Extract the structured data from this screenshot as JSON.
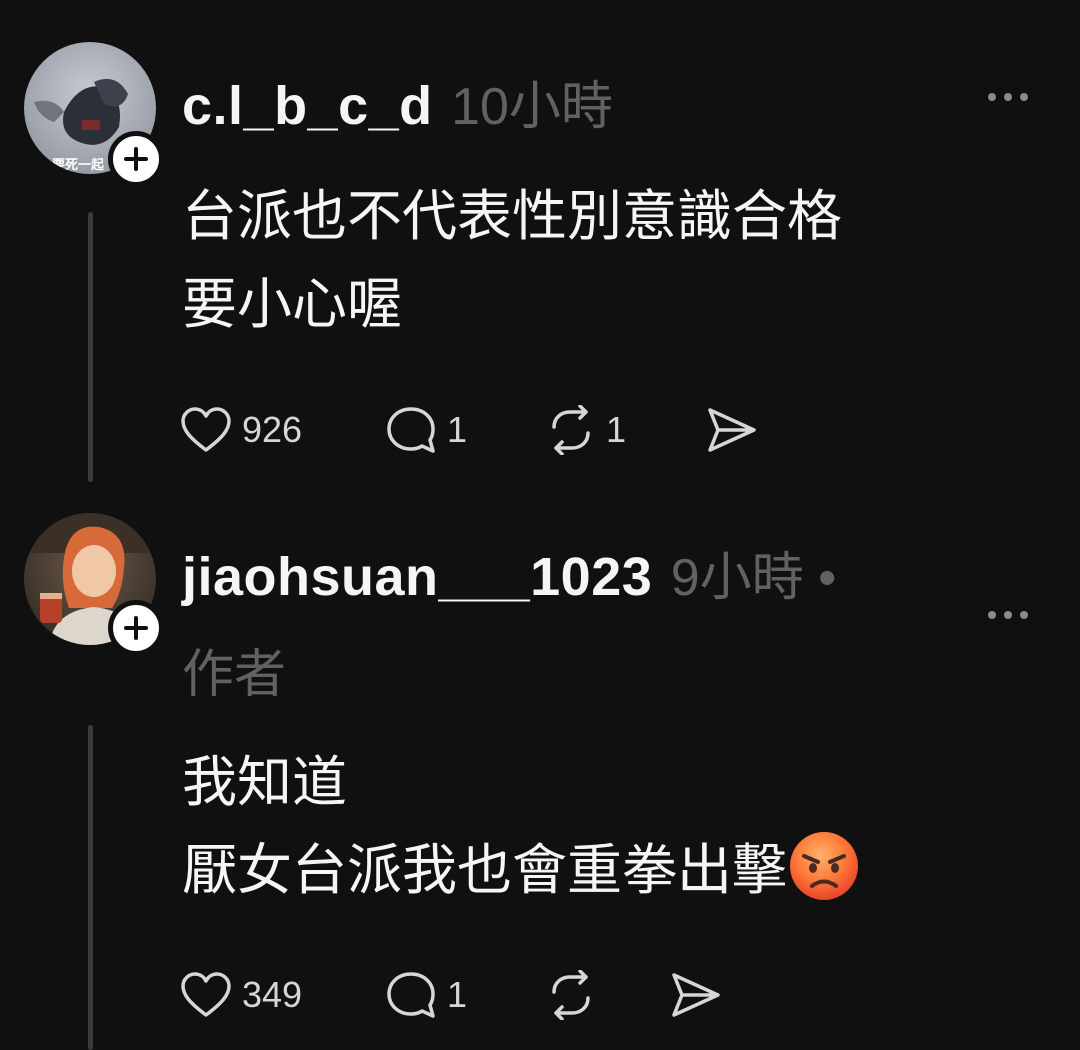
{
  "posts": [
    {
      "username": "c.l_b_c_d",
      "time": "10小時",
      "text_lines": [
        "台派也不代表性別意識合格",
        "要小心喔"
      ],
      "avatar_caption": "要死一起",
      "likes": "926",
      "replies": "1",
      "reposts": "1",
      "more_icon": "more-icon",
      "follow_icon": "plus-icon"
    },
    {
      "username": "jiaohsuan___1023",
      "time": "9小時",
      "separator": "•",
      "author_label": "作者",
      "text_lines": [
        "我知道",
        "厭女台派我也會重拳出擊"
      ],
      "emoji": "angry-face-emoji",
      "likes": "349",
      "replies": "1",
      "reposts": "",
      "more_icon": "more-icon",
      "follow_icon": "plus-icon"
    }
  ],
  "icons": {
    "like": "heart-icon",
    "reply": "comment-icon",
    "repost": "repost-icon",
    "share": "send-icon"
  },
  "colors": {
    "background": "#101010",
    "primary_text": "#f3f5f7",
    "secondary_text": "#616161",
    "thread_line": "#3a3a3a"
  }
}
